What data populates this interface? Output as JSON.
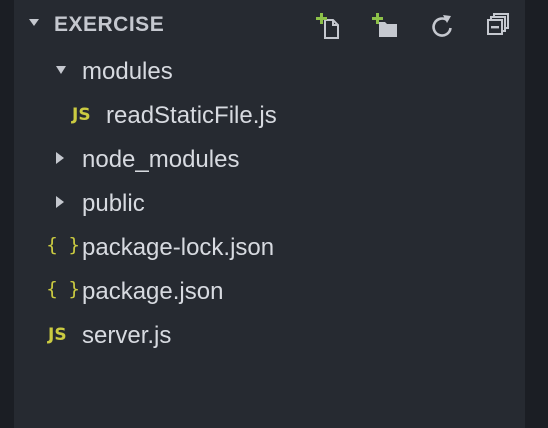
{
  "explorer": {
    "title": "EXERCISE",
    "actions": [
      {
        "name": "new-file-icon"
      },
      {
        "name": "new-folder-icon"
      },
      {
        "name": "refresh-icon"
      },
      {
        "name": "collapse-all-icon"
      }
    ],
    "colors": {
      "panel_bg": "#262a31",
      "outer_bg": "#1b1e24",
      "text": "#d7dae0",
      "icon_accent": "#8dc149",
      "js_icon": "#cbcb41"
    },
    "items": [
      {
        "label": "modules",
        "type": "folder",
        "expanded": true,
        "depth": 0
      },
      {
        "label": "readStaticFile.js",
        "type": "file",
        "icon_text": "JS",
        "depth": 1
      },
      {
        "label": "node_modules",
        "type": "folder",
        "expanded": false,
        "depth": 0
      },
      {
        "label": "public",
        "type": "folder",
        "expanded": false,
        "depth": 0
      },
      {
        "label": "package-lock.json",
        "type": "file",
        "icon_text": "{ }",
        "depth": 0
      },
      {
        "label": "package.json",
        "type": "file",
        "icon_text": "{ }",
        "depth": 0
      },
      {
        "label": "server.js",
        "type": "file",
        "icon_text": "JS",
        "depth": 0
      }
    ]
  }
}
